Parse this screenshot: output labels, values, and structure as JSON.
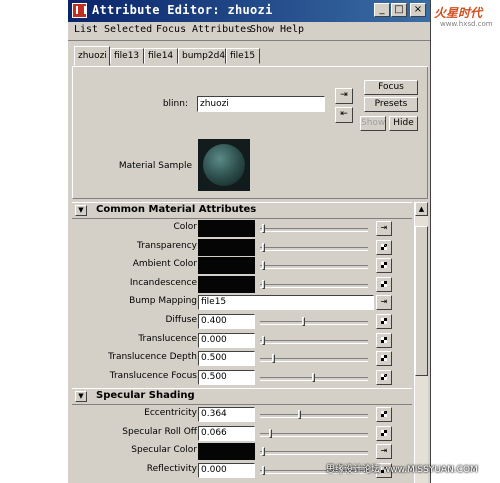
{
  "window": {
    "title": "Attribute Editor: zhuozi",
    "minimize_label": "_",
    "maximize_label": "□",
    "close_label": "×"
  },
  "menu": [
    "List",
    "Selected",
    "Focus",
    "Attributes",
    "Show",
    "Help"
  ],
  "tabs": [
    "zhuozi",
    "file13",
    "file14",
    "bump2d4",
    "file15"
  ],
  "active_tab": "zhuozi",
  "header": {
    "type_label": "blinn:",
    "name_value": "zhuozi",
    "focus_label": "Focus",
    "presets_label": "Presets",
    "show_label": "Show",
    "hide_label": "Hide",
    "material_sample_label": "Material Sample"
  },
  "sections": {
    "common": {
      "title": "Common Material Attributes",
      "rows": [
        {
          "label": "Color",
          "kind": "swatch",
          "slider": 0.0
        },
        {
          "label": "Transparency",
          "kind": "swatch",
          "slider": 0.0
        },
        {
          "label": "Ambient Color",
          "kind": "swatch",
          "slider": 0.0
        },
        {
          "label": "Incandescence",
          "kind": "swatch",
          "slider": 0.0
        },
        {
          "label": "Bump Mapping",
          "kind": "text",
          "value": "file15"
        },
        {
          "label": "Diffuse",
          "kind": "number",
          "value": "0.400",
          "slider": 0.4
        },
        {
          "label": "Translucence",
          "kind": "number",
          "value": "0.000",
          "slider": 0.0
        },
        {
          "label": "Translucence Depth",
          "kind": "number",
          "value": "0.500",
          "slider": 0.1
        },
        {
          "label": "Translucence Focus",
          "kind": "number",
          "value": "0.500",
          "slider": 0.5
        }
      ]
    },
    "specular": {
      "title": "Specular Shading",
      "rows": [
        {
          "label": "Eccentricity",
          "kind": "number",
          "value": "0.364",
          "slider": 0.36
        },
        {
          "label": "Specular Roll Off",
          "kind": "number",
          "value": "0.066",
          "slider": 0.07
        },
        {
          "label": "Specular Color",
          "kind": "swatch",
          "slider": 0.0
        },
        {
          "label": "Reflectivity",
          "kind": "number",
          "value": "0.000",
          "slider": 0.0
        }
      ]
    }
  },
  "watermarks": {
    "logo": "火星时代",
    "logo_sub": "www.hxsd.com",
    "bottom": "思缘设计论坛 www.MISSYUAN.COM"
  },
  "colors": {
    "titlebar": "#0a246a",
    "panel": "#d4d0c8",
    "swatch": "#050505"
  }
}
